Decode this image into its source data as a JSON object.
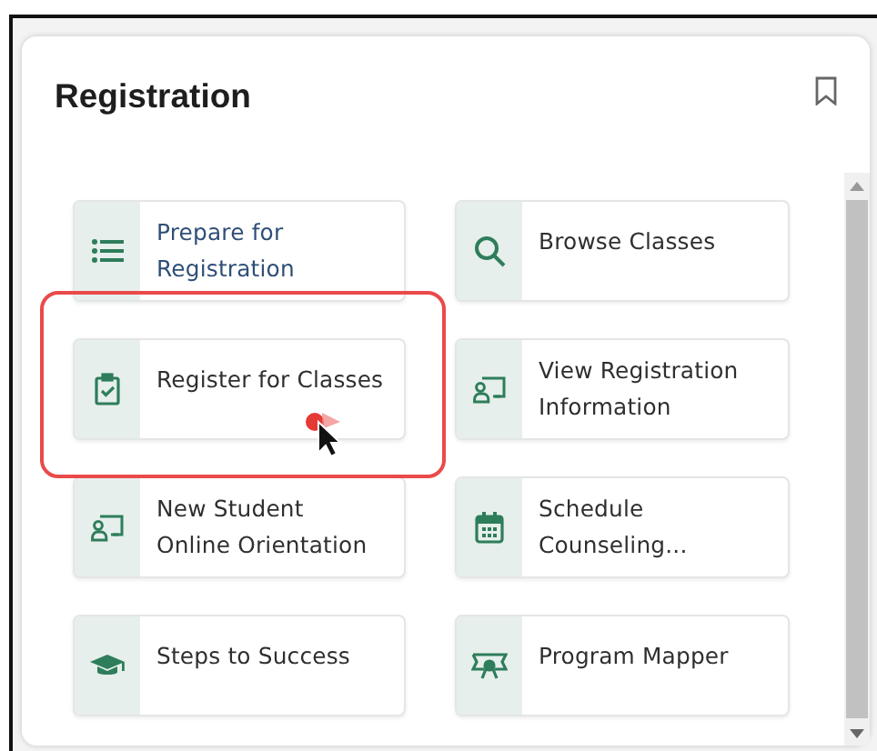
{
  "card": {
    "title": "Registration",
    "bookmarked": false
  },
  "tiles": [
    {
      "label": "Prepare for\nRegistration",
      "visited": true,
      "highlighted": false
    },
    {
      "label": "Browse Classes",
      "visited": false,
      "highlighted": false
    },
    {
      "label": "Register for Classes",
      "visited": false,
      "highlighted": true
    },
    {
      "label": "View Registration\nInformation",
      "visited": false,
      "highlighted": false
    },
    {
      "label": "New Student\nOnline Orientation",
      "visited": false,
      "highlighted": false
    },
    {
      "label": "Schedule\nCounseling...",
      "visited": false,
      "highlighted": false
    },
    {
      "label": "Steps to Success",
      "visited": false,
      "highlighted": false
    },
    {
      "label": "Program Mapper",
      "visited": false,
      "highlighted": false
    }
  ]
}
